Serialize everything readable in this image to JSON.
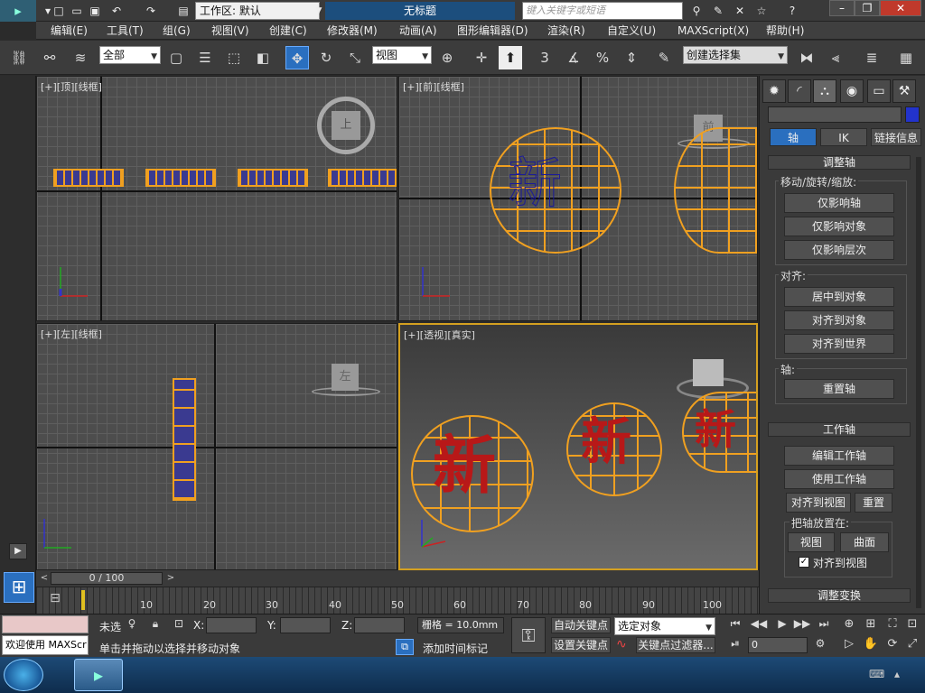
{
  "titlebar": {
    "app_logo": "3ds Max",
    "workspace": "工作区: 默认",
    "doc_title": "无标题",
    "search_placeholder": "键入关键字或短语"
  },
  "menu": [
    "编辑(E)",
    "工具(T)",
    "组(G)",
    "视图(V)",
    "创建(C)",
    "修改器(M)",
    "动画(A)",
    "图形编辑器(D)",
    "渲染(R)",
    "自定义(U)",
    "MAXScript(X)",
    "帮助(H)"
  ],
  "toolbar": {
    "selection_filter": "全部",
    "ref_coord": "视图",
    "named_selection": "创建选择集",
    "snap_label": "3",
    "percent": "%"
  },
  "viewports": {
    "top": {
      "label": "[+][顶][线框]",
      "cube": "上"
    },
    "front": {
      "label": "[+][前][线框]",
      "cube": "前"
    },
    "left": {
      "label": "[+][左][线框]",
      "cube": "左"
    },
    "persp": {
      "label": "[+][透视][真实]"
    }
  },
  "panel": {
    "tabs": [
      "轴",
      "IK",
      "链接信息"
    ],
    "rollout_adjust": "调整轴",
    "group_move": "移动/旋转/缩放:",
    "btn_affect_pivot": "仅影响轴",
    "btn_affect_object": "仅影响对象",
    "btn_affect_hier": "仅影响层次",
    "group_align": "对齐:",
    "btn_center": "居中到对象",
    "btn_align_obj": "对齐到对象",
    "btn_align_world": "对齐到世界",
    "group_pivot": "轴:",
    "btn_reset_pivot": "重置轴",
    "rollout_working": "工作轴",
    "btn_edit_wp": "编辑工作轴",
    "btn_use_wp": "使用工作轴",
    "btn_align_view": "对齐到视图",
    "btn_reset": "重置",
    "group_place": "把轴放置在:",
    "btn_view": "视图",
    "btn_surface": "曲面",
    "chk_align_view": "对齐到视图",
    "rollout_transform": "调整变换"
  },
  "timeline": {
    "frame": "0 / 100",
    "ticks": [
      "10",
      "20",
      "30",
      "40",
      "50",
      "60",
      "70",
      "80",
      "90",
      "100"
    ]
  },
  "status": {
    "welcome": "欢迎使用 MAXScr",
    "unselected": "未选",
    "x_label": "X:",
    "y_label": "Y:",
    "z_label": "Z:",
    "grid": "栅格 = 10.0mm",
    "prompt": "单击并拖动以选择并移动对象",
    "add_time_tag": "添加时间标记",
    "auto_key": "自动关键点",
    "set_key": "设置关键点",
    "key_mode": "选定对象",
    "key_filters": "关键点过滤器...",
    "frame_value": "0"
  },
  "colors": {
    "orange": "#f0a020",
    "blue": "#1a1a9a",
    "red": "#b81818",
    "accent": "#2a6fbf"
  }
}
